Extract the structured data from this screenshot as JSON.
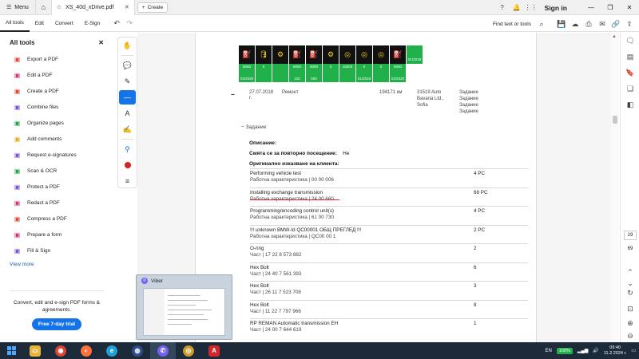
{
  "window": {
    "menu_label": "Menu",
    "tab_title": "XS_40d_xDrive.pdf",
    "create_label": "Create",
    "sign_in": "Sign in"
  },
  "toolbar": {
    "menus": [
      "All tools",
      "Edit",
      "Convert",
      "E-Sign"
    ],
    "find_label": "Find text or tools"
  },
  "left_panel": {
    "title": "All tools",
    "items": [
      {
        "label": "Export a PDF",
        "icon": "export-pdf-icon",
        "color": "#e8433a"
      },
      {
        "label": "Edit a PDF",
        "icon": "edit-pdf-icon",
        "color": "#d9336c"
      },
      {
        "label": "Create a PDF",
        "icon": "create-pdf-icon",
        "color": "#e8433a"
      },
      {
        "label": "Combine files",
        "icon": "combine-files-icon",
        "color": "#7c4dd6"
      },
      {
        "label": "Organize pages",
        "icon": "organize-pages-icon",
        "color": "#24a148"
      },
      {
        "label": "Add comments",
        "icon": "add-comments-icon",
        "color": "#e7a81a"
      },
      {
        "label": "Request e-signatures",
        "icon": "request-esignatures-icon",
        "color": "#7c4dd6"
      },
      {
        "label": "Scan & OCR",
        "icon": "scan-ocr-icon",
        "color": "#24a148"
      },
      {
        "label": "Protect a PDF",
        "icon": "protect-pdf-icon",
        "color": "#7c4dd6"
      },
      {
        "label": "Redact a PDF",
        "icon": "redact-pdf-icon",
        "color": "#d9336c"
      },
      {
        "label": "Compress a PDF",
        "icon": "compress-pdf-icon",
        "color": "#e8433a"
      },
      {
        "label": "Prepare a form",
        "icon": "prepare-form-icon",
        "color": "#d9336c"
      },
      {
        "label": "Fill & Sign",
        "icon": "fill-sign-icon",
        "color": "#7c4dd6"
      }
    ],
    "view_more": "View more",
    "promo_text": "Convert, edit and e-sign PDF forms & agreements.",
    "trial_button": "Free 7-day trial"
  },
  "document": {
    "service_icons": [
      {
        "v1": "6000",
        "v2": "02/2020"
      },
      {
        "v1": "0",
        "v2": ""
      },
      {
        "v1": "",
        "v2": ""
      },
      {
        "v1": "6000",
        "v2": "100"
      },
      {
        "v1": "6000",
        "v2": "500"
      },
      {
        "v1": "0",
        "v2": ""
      },
      {
        "v1": "15000",
        "v2": ""
      },
      {
        "v1": "0",
        "v2": "01/2019"
      },
      {
        "v1": "0",
        "v2": ""
      },
      {
        "v1": "6000",
        "v2": "02/2020"
      },
      {
        "v1": "",
        "v2": "01/2019"
      }
    ],
    "record": {
      "date": "27.07.2018",
      "date_suffix": "г.",
      "type": "Ремонт",
      "km": "194171 км",
      "dealer_line1": "31519 Auto",
      "dealer_line2": "Bavaria Ltd.,",
      "dealer_line3": "Sofia",
      "tasks": [
        "Задание",
        "Задание",
        "Задание",
        "Задание"
      ]
    },
    "zadanie_label": "Задание",
    "description_label": "Описание:",
    "revisit_label": "Смята се за повторно посещение:",
    "revisit_value": "Не",
    "original_request_label": "Оригинално изказване на клиента:",
    "items": [
      {
        "name": "Performing vehicle test",
        "sub": "Работна характеристика | 00 00 006",
        "qty": "4 PC"
      },
      {
        "name": "Installing exchange transmission",
        "sub": "Работна характеристика | 24 00 660",
        "qty": "68 PC"
      },
      {
        "name": "Programming/encoding control unit(s)",
        "sub": "Работна характеристика | 61 00 730",
        "qty": "4 PC"
      },
      {
        "name": "!!! unknown BMW-Id QC00001 ОБЩ ПРЕГЛЕД !!!",
        "sub": "Работна характеристика | QC00 00 1",
        "qty": "2 PC"
      },
      {
        "name": "O-ring",
        "sub": "Част | 17 22 8 573 882",
        "qty": "2"
      },
      {
        "name": "Hex Bolt",
        "sub": "Част | 24 40 7 561 393",
        "qty": "6"
      },
      {
        "name": "Hex Bolt",
        "sub": "Част | 26 11 7 523 708",
        "qty": "3"
      },
      {
        "name": "Hex Bolt",
        "sub": "Част | 11 22 7 797 966",
        "qty": "8"
      },
      {
        "name": "RP REMAN Automatic transmission EH",
        "sub": "Част | 24 00 7 644 619",
        "qty": "1"
      }
    ]
  },
  "right_panel": {
    "page_current": "19",
    "page_total": "69"
  },
  "popup": {
    "app_name": "Viber"
  },
  "taskbar": {
    "lang": "EN",
    "battery": "100%",
    "time": "09:40",
    "date": "11.2.2024 г."
  }
}
